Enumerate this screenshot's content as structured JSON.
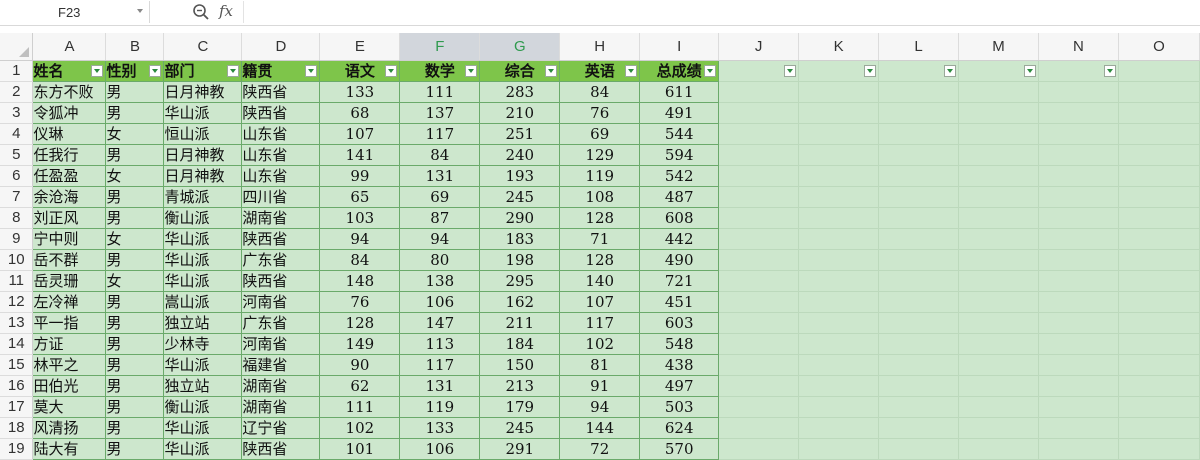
{
  "formula_bar": {
    "cell_ref": "F23",
    "formula_value": ""
  },
  "icons": {
    "zoom": "zoom-icon",
    "fx": "fx"
  },
  "columns": [
    "A",
    "B",
    "C",
    "D",
    "E",
    "F",
    "G",
    "H",
    "I",
    "J",
    "K",
    "L",
    "M",
    "N",
    "O"
  ],
  "selected_columns": [
    "F",
    "G"
  ],
  "headers": [
    "姓名",
    "性别",
    "部门",
    "籍贯",
    "语文",
    "数学",
    "综合",
    "英语",
    "总成绩"
  ],
  "rows": [
    [
      "东方不败",
      "男",
      "日月神教",
      "陕西省",
      "133",
      "111",
      "283",
      "84",
      "611"
    ],
    [
      "令狐冲",
      "男",
      "华山派",
      "陕西省",
      "68",
      "137",
      "210",
      "76",
      "491"
    ],
    [
      "仪琳",
      "女",
      "恒山派",
      "山东省",
      "107",
      "117",
      "251",
      "69",
      "544"
    ],
    [
      "任我行",
      "男",
      "日月神教",
      "山东省",
      "141",
      "84",
      "240",
      "129",
      "594"
    ],
    [
      "任盈盈",
      "女",
      "日月神教",
      "山东省",
      "99",
      "131",
      "193",
      "119",
      "542"
    ],
    [
      "余沧海",
      "男",
      "青城派",
      "四川省",
      "65",
      "69",
      "245",
      "108",
      "487"
    ],
    [
      "刘正风",
      "男",
      "衡山派",
      "湖南省",
      "103",
      "87",
      "290",
      "128",
      "608"
    ],
    [
      "宁中则",
      "女",
      "华山派",
      "陕西省",
      "94",
      "94",
      "183",
      "71",
      "442"
    ],
    [
      "岳不群",
      "男",
      "华山派",
      "广东省",
      "84",
      "80",
      "198",
      "128",
      "490"
    ],
    [
      "岳灵珊",
      "女",
      "华山派",
      "陕西省",
      "148",
      "138",
      "295",
      "140",
      "721"
    ],
    [
      "左冷禅",
      "男",
      "嵩山派",
      "河南省",
      "76",
      "106",
      "162",
      "107",
      "451"
    ],
    [
      "平一指",
      "男",
      "独立站",
      "广东省",
      "128",
      "147",
      "211",
      "117",
      "603"
    ],
    [
      "方证",
      "男",
      "少林寺",
      "河南省",
      "149",
      "113",
      "184",
      "102",
      "548"
    ],
    [
      "林平之",
      "男",
      "华山派",
      "福建省",
      "90",
      "117",
      "150",
      "81",
      "438"
    ],
    [
      "田伯光",
      "男",
      "独立站",
      "湖南省",
      "62",
      "131",
      "213",
      "91",
      "497"
    ],
    [
      "莫大",
      "男",
      "衡山派",
      "湖南省",
      "111",
      "119",
      "179",
      "94",
      "503"
    ],
    [
      "风清扬",
      "男",
      "华山派",
      "辽宁省",
      "102",
      "133",
      "245",
      "144",
      "624"
    ],
    [
      "陆大有",
      "男",
      "华山派",
      "陕西省",
      "101",
      "106",
      "291",
      "72",
      "570"
    ]
  ],
  "row_numbers": [
    "1",
    "2",
    "3",
    "4",
    "5",
    "6",
    "7",
    "8",
    "9",
    "10",
    "11",
    "12",
    "13",
    "14",
    "15",
    "16",
    "17",
    "18",
    "19"
  ],
  "colors": {
    "header_fill": "#7ec54a",
    "cell_fill": "#cde7cd",
    "selected_col_text": "#2f9a4e"
  }
}
